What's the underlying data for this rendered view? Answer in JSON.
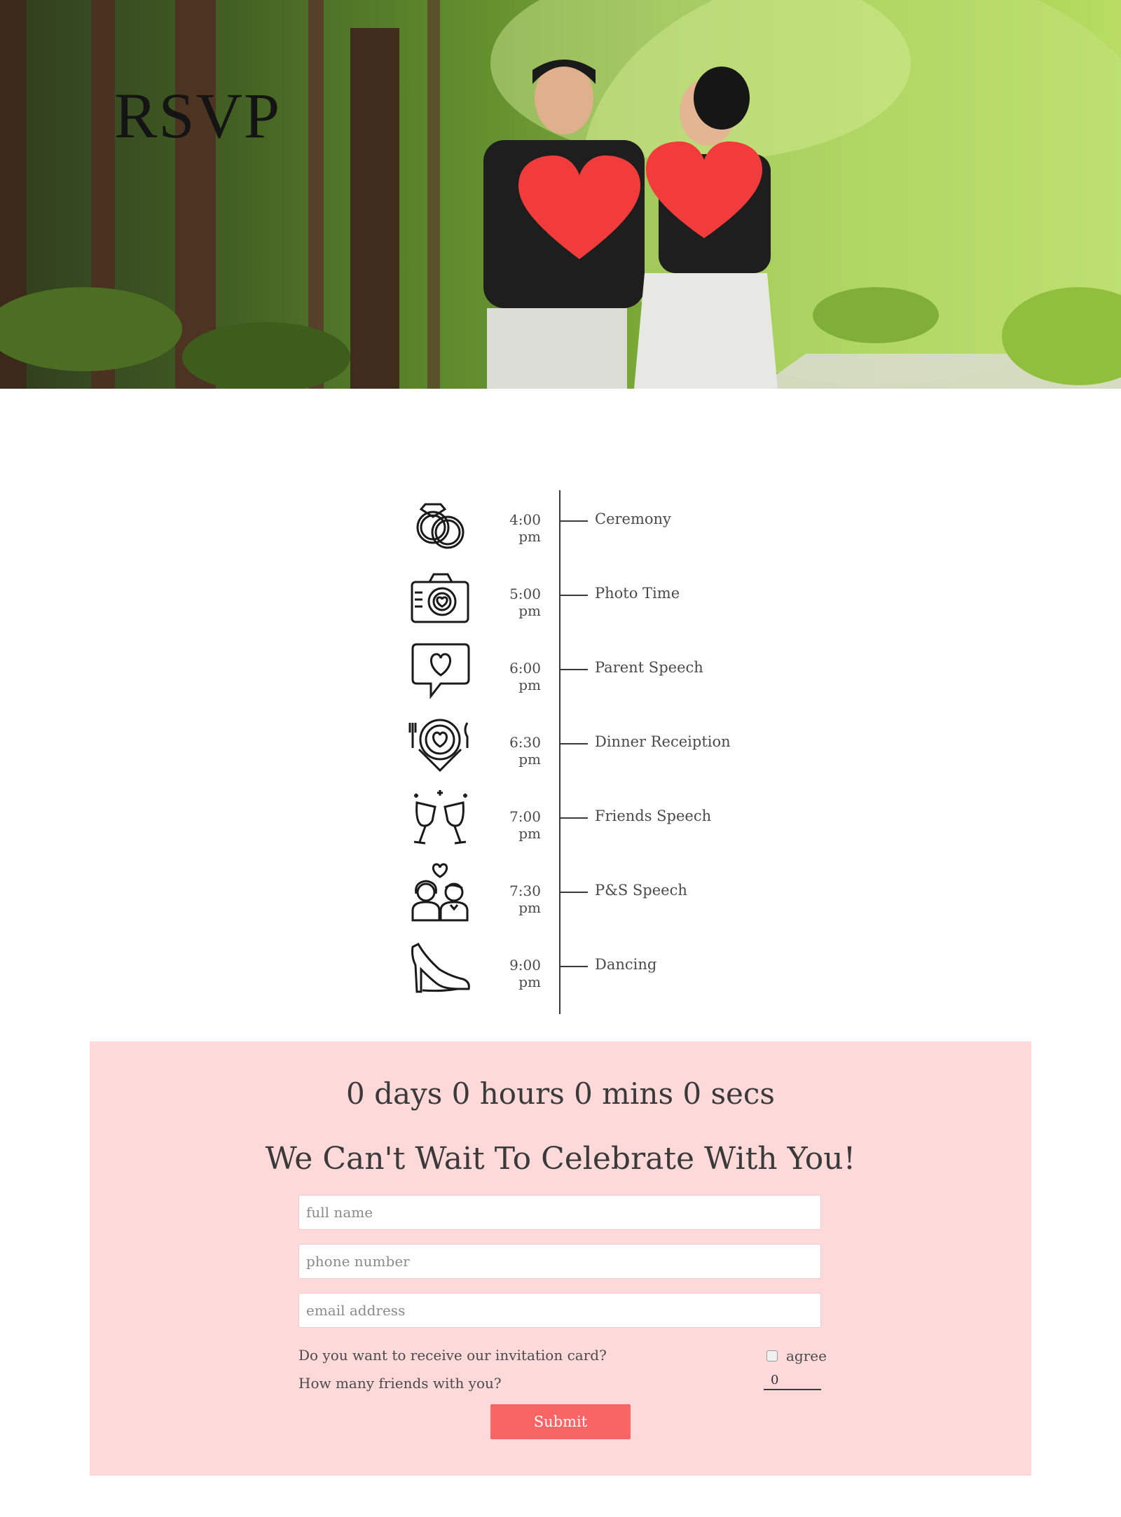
{
  "hero": {
    "title": "RSVP",
    "photo_description_icon": "couple-with-hearts-photo"
  },
  "timeline": [
    {
      "time": "4:00 pm",
      "event": "Ceremony",
      "icon": "rings-icon"
    },
    {
      "time": "5:00 pm",
      "event": "Photo Time",
      "icon": "camera-icon"
    },
    {
      "time": "6:00 pm",
      "event": "Parent Speech",
      "icon": "speech-bubble-heart-icon"
    },
    {
      "time": "6:30 pm",
      "event": "Dinner Receiption",
      "icon": "dinner-plate-icon"
    },
    {
      "time": "7:00 pm",
      "event": "Friends Speech",
      "icon": "toast-glasses-icon"
    },
    {
      "time": "7:30 pm",
      "event": "P&S Speech",
      "icon": "couple-icon"
    },
    {
      "time": "9:00 pm",
      "event": "Dancing",
      "icon": "high-heel-icon"
    }
  ],
  "rsvp": {
    "countdown": "0 days 0 hours 0 mins 0 secs",
    "headline": "We Can't Wait To Celebrate With You!",
    "fields": {
      "full_name_placeholder": "full name",
      "phone_placeholder": "phone number",
      "email_placeholder": "email address"
    },
    "invitation_question": "Do you want to receive our invitation card?",
    "agree_label": "agree",
    "friends_question": "How many friends with you?",
    "friends_value": "0",
    "submit_label": "Submit"
  },
  "colors": {
    "panel_bg": "#fdd9da",
    "submit_bg": "#f96464",
    "heart": "#f23b3b",
    "text": "#3a3a3a"
  }
}
